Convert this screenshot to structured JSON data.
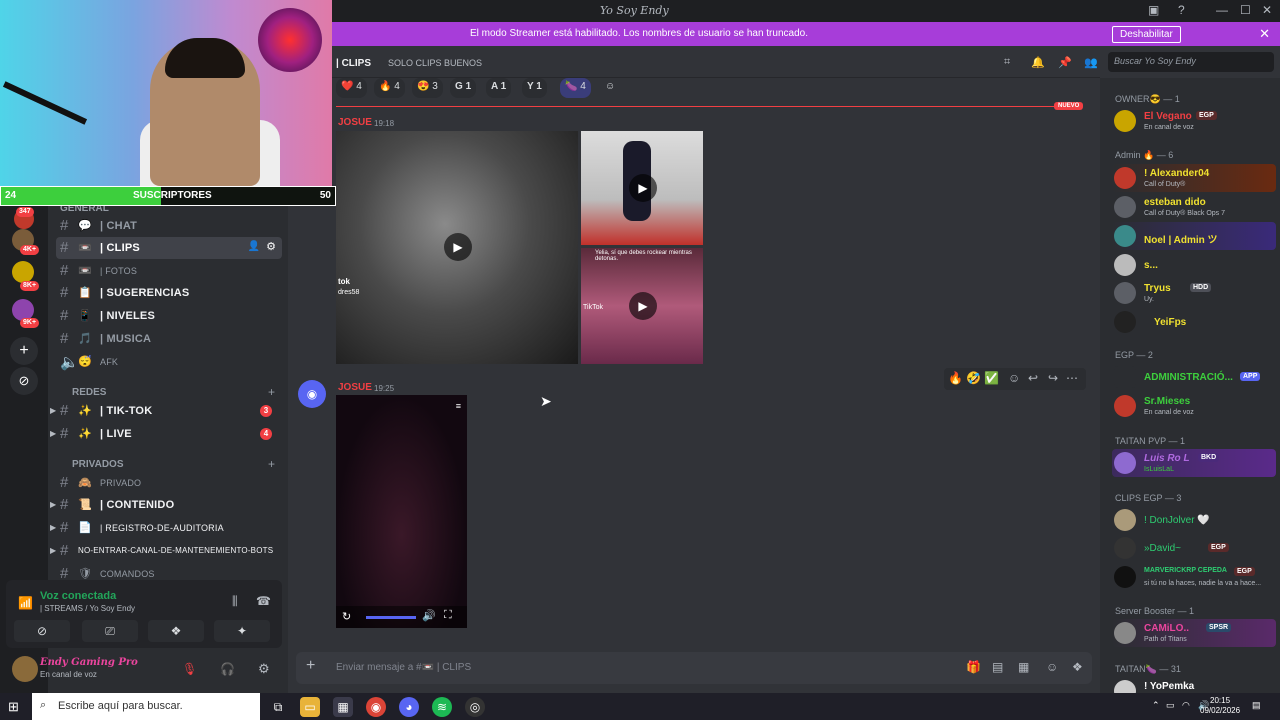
{
  "window": {
    "title": "Yo Soy Endy"
  },
  "banner": {
    "message": "El modo Streamer está habilitado. Los nombres de usuario se han truncado.",
    "button": "Deshabilitar",
    "close": "✕"
  },
  "stream": {
    "subs_label": "SUSCRIPTORES",
    "subs_current": "24",
    "subs_goal": "50",
    "subs_progress": 0.48
  },
  "guilds": [
    {
      "badge": "347"
    },
    {
      "badge": "4K+"
    },
    {
      "badge": "8K+"
    },
    {
      "badge": "9K+"
    }
  ],
  "channels": {
    "general_label": "GENERAL",
    "items": [
      {
        "emoji": "💬",
        "name": "| CHAT"
      },
      {
        "emoji": "📼",
        "name": "| CLIPS"
      },
      {
        "emoji": "📼",
        "name": "| FOTOS"
      },
      {
        "emoji": "📋",
        "name": "| SUGERENCIAS"
      },
      {
        "emoji": "📱",
        "name": "| NIVELES"
      },
      {
        "emoji": "🎵",
        "name": "| MUSICA"
      },
      {
        "emoji": "😴",
        "name": "AFK"
      }
    ],
    "redes": {
      "label": "REDES",
      "items": [
        {
          "emoji": "✨",
          "name": "| TIK-TOK",
          "count": "3"
        },
        {
          "emoji": "✨",
          "name": "| LIVE",
          "count": "4"
        }
      ]
    },
    "privados": {
      "label": "PRIVADOS",
      "items": [
        {
          "emoji": "🙈",
          "name": "PRIVADO"
        },
        {
          "emoji": "📜",
          "name": "| CONTENIDO"
        },
        {
          "emoji": "📄",
          "name": "| REGISTRO-DE-AUDITORIA"
        },
        {
          "emoji": "",
          "name": "NO-ENTRAR-CANAL-DE-MANTENEMIENTO-BOTS"
        },
        {
          "emoji": "🛡",
          "name": "COMANDOS"
        }
      ]
    }
  },
  "voice": {
    "status": "Voz conectada",
    "channel": "| STREAMS / Yo Soy Endy"
  },
  "user": {
    "name": "Endy Gaming Pro",
    "status": "En canal de voz"
  },
  "header": {
    "channel": "| CLIPS",
    "topic": "SOLO CLIPS BUENOS",
    "search_placeholder": "Buscar Yo Soy Endy"
  },
  "reactions": [
    {
      "emoji": "❤️",
      "count": "4"
    },
    {
      "emoji": "🔥",
      "count": "4"
    },
    {
      "emoji": "😍",
      "count": "3"
    },
    {
      "emoji": "G",
      "count": "1"
    },
    {
      "emoji": "A",
      "count": "1"
    },
    {
      "emoji": "Y",
      "count": "1"
    },
    {
      "emoji": "🍆",
      "count": "4"
    }
  ],
  "new_label": "NUEVO",
  "messages": [
    {
      "author": "JOSUE",
      "time": "19:18",
      "overlay": [
        "tok",
        "dres58"
      ],
      "clip_text": "Yelia, sí que debes rockear mientras detonas.",
      "tiktok": "TikTok"
    },
    {
      "author": "JOSUE",
      "time": "19:25"
    }
  ],
  "composer": {
    "placeholder": "Enviar mensaje a #📼 | CLIPS"
  },
  "members": {
    "categories": [
      {
        "label": "OWNER😎 — 1"
      },
      {
        "label": "Admin 🔥 — 6"
      },
      {
        "label": "EGP — 2"
      },
      {
        "label": "TAITAN PVP — 1"
      },
      {
        "label": "CLIPS EGP — 3"
      },
      {
        "label": "Server Booster — 1"
      },
      {
        "label": "TAITAN🍆 — 31"
      }
    ],
    "list": [
      {
        "name": "El Vegano",
        "status": "En canal de voz",
        "color": "#f23f43",
        "tag": "EGP"
      },
      {
        "name": "! Alexander04",
        "status": "Call of Duty®",
        "color": "#f0e130"
      },
      {
        "name": "esteban dido",
        "status": "Call of Duty® Black Ops 7",
        "color": "#f0e130"
      },
      {
        "name": "Noel | Admin ツ",
        "status": "",
        "color": "#f0e130"
      },
      {
        "name": "s...",
        "status": "",
        "color": "#f0e130"
      },
      {
        "name": "Tryus",
        "status": "Uy.",
        "color": "#f0e130",
        "tag": "HDD"
      },
      {
        "name": "YeiFps",
        "status": "",
        "color": "#f0e130"
      },
      {
        "name": "ADMINISTRACIÓ...",
        "status": "",
        "color": "#3dcf3d",
        "tag": "APP"
      },
      {
        "name": "Sr.Mieses",
        "status": "En canal de voz",
        "color": "#3dcf3d"
      },
      {
        "name": "Luis Ro L",
        "status": "IsLuisLaL",
        "color": "#b06ae0",
        "tag": "BKD"
      },
      {
        "name": "! DonJolver 🤍",
        "status": "",
        "color": "#2ecc71"
      },
      {
        "name": "»David~",
        "status": "",
        "color": "#2ecc71",
        "tag": "EGP"
      },
      {
        "name": "MARVERICKRP CEPEDA",
        "status": "si tú no la haces, nadie la va a hace...",
        "color": "#2ecc71",
        "tag": "EGP"
      },
      {
        "name": "CAMiLO..",
        "status": "Path of Titans",
        "color": "#eb459e",
        "tag": "SPSR"
      },
      {
        "name": "! YoPemka",
        "status": "",
        "color": "#ffffff"
      }
    ]
  },
  "taskbar": {
    "search": "Escribe aquí para buscar.",
    "time": "20:15",
    "date": "09/02/2026"
  }
}
